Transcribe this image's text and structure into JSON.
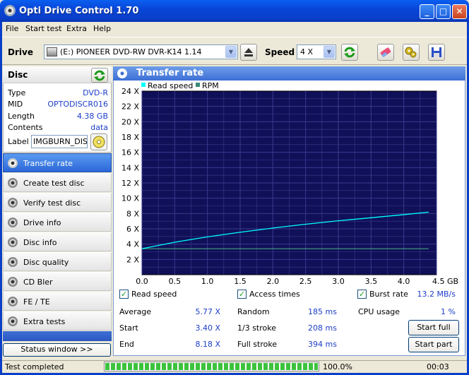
{
  "window": {
    "title": "Opti Drive Control 1.70"
  },
  "menu": [
    "File",
    "Start test",
    "Extra",
    "Help"
  ],
  "toolbar": {
    "drive_label": "Drive",
    "drive_value": "(E:)  PIONEER DVD-RW  DVR-K14 1.14",
    "speed_label": "Speed",
    "speed_value": "4 X"
  },
  "disc": {
    "heading": "Disc",
    "fields": [
      {
        "key": "Type",
        "value": "DVD-R"
      },
      {
        "key": "MID",
        "value": "OPTODISCR016"
      },
      {
        "key": "Length",
        "value": "4.38 GB"
      },
      {
        "key": "Contents",
        "value": "data"
      }
    ],
    "label_key": "Label",
    "label_value": "IMGBURN_DIS"
  },
  "nav": [
    {
      "label": "Transfer rate",
      "active": true
    },
    {
      "label": "Create test disc",
      "active": false
    },
    {
      "label": "Verify test disc",
      "active": false
    },
    {
      "label": "Drive info",
      "active": false
    },
    {
      "label": "Disc info",
      "active": false
    },
    {
      "label": "Disc quality",
      "active": false
    },
    {
      "label": "CD Bler",
      "active": false
    },
    {
      "label": "FE / TE",
      "active": false
    },
    {
      "label": "Extra tests",
      "active": false
    }
  ],
  "status_window_button": "Status window >>",
  "panel": {
    "title": "Transfer rate"
  },
  "chart_data": {
    "type": "line",
    "legend": [
      {
        "name": "Read speed",
        "color": "#00ffff"
      },
      {
        "name": "RPM",
        "color": "#3a8a78"
      }
    ],
    "x_ticks": [
      "0.0",
      "0.5",
      "1.0",
      "1.5",
      "2.0",
      "2.5",
      "3.0",
      "3.5",
      "4.0",
      "4.5 GB"
    ],
    "y_ticks": [
      "24 X",
      "22 X",
      "20 X",
      "18 X",
      "16 X",
      "14 X",
      "12 X",
      "10 X",
      "8 X",
      "6 X",
      "4 X",
      "2 X"
    ],
    "xlim": [
      0,
      4.5
    ],
    "ylim": [
      0,
      24
    ],
    "series": [
      {
        "name": "Read speed",
        "x": [
          0,
          0.5,
          1.0,
          1.5,
          2.0,
          2.5,
          3.0,
          3.5,
          4.0,
          4.38
        ],
        "y": [
          3.4,
          4.25,
          4.95,
          5.55,
          6.1,
          6.6,
          7.05,
          7.45,
          7.85,
          8.18
        ]
      },
      {
        "name": "RPM",
        "x": [
          0,
          4.38
        ],
        "y": [
          3.4,
          3.4
        ]
      }
    ],
    "background": "#101058",
    "grid": true
  },
  "checks": {
    "read_speed": {
      "label": "Read speed",
      "checked": true
    },
    "access_times": {
      "label": "Access times",
      "checked": true
    },
    "burst_rate": {
      "label": "Burst rate",
      "checked": true,
      "value": "13.2 MB/s"
    }
  },
  "stats": {
    "average": {
      "label": "Average",
      "value": "5.77 X"
    },
    "start": {
      "label": "Start",
      "value": "3.40 X"
    },
    "end": {
      "label": "End",
      "value": "8.18 X"
    },
    "random": {
      "label": "Random",
      "value": "185 ms"
    },
    "third": {
      "label": "1/3 stroke",
      "value": "208 ms"
    },
    "full": {
      "label": "Full stroke",
      "value": "394 ms"
    },
    "cpu": {
      "label": "CPU usage",
      "value": "1 %"
    }
  },
  "buttons": {
    "start_full": "Start full",
    "start_part": "Start part"
  },
  "status": {
    "text": "Test completed",
    "progress": 1.0,
    "progress_text": "100.0%",
    "time": "00:03"
  }
}
